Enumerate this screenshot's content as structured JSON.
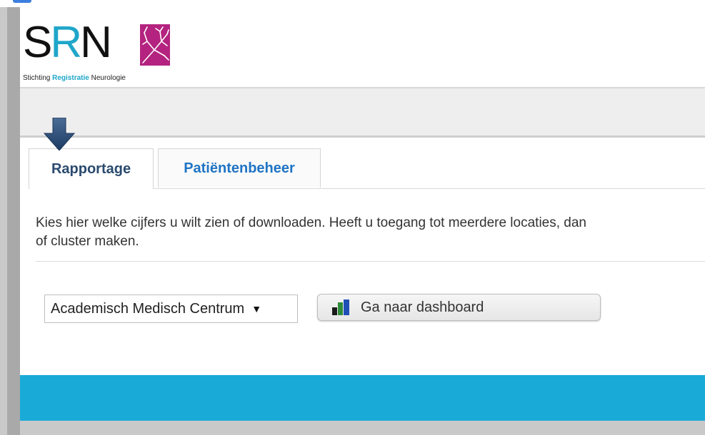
{
  "brand": {
    "letter_s": "S",
    "letter_r": "R",
    "letter_n": "N",
    "tagline_part1": "Stichting ",
    "tagline_highlight": "Registratie",
    "tagline_part2": " Neurologie",
    "accent_color": "#1fa6c9",
    "logo_box_color": "#b4237f"
  },
  "tabs": [
    {
      "label": "Rapportage",
      "active": true
    },
    {
      "label": "Patiëntenbeheer",
      "active": false
    }
  ],
  "content": {
    "description": "Kies hier welke cijfers u wilt zien of downloaden. Heeft u toegang tot meerdere locaties, dan",
    "description_line2": "of cluster maken."
  },
  "location_select": {
    "value": "Academisch Medisch Centrum",
    "caret": "▼"
  },
  "dashboard_button": {
    "label": "Ga naar dashboard",
    "icon": "bar-chart-icon"
  },
  "colors": {
    "footer": "#1aaad7",
    "active_tab_text": "#2a4a6f",
    "link_tab_text": "#1f74c4"
  }
}
